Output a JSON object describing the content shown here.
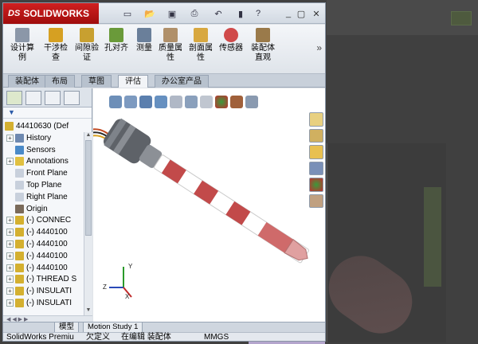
{
  "app": {
    "brand": "SOLIDWORKS",
    "brand_logo": "DS"
  },
  "quick_access": [
    "new-icon",
    "open-icon",
    "save-icon",
    "print-icon",
    "undo-icon",
    "rebuild-icon",
    "help-icon"
  ],
  "window_controls": [
    "minimize",
    "restore",
    "close"
  ],
  "ribbon": {
    "commands": [
      {
        "id": "design-study",
        "label": "设计算\n例"
      },
      {
        "id": "interference",
        "label": "干涉检\n查"
      },
      {
        "id": "clearance",
        "label": "间隙验\n证"
      },
      {
        "id": "hole-align",
        "label": "孔对齐"
      },
      {
        "id": "measure",
        "label": "测量"
      },
      {
        "id": "mass-props",
        "label": "质量属\n性"
      },
      {
        "id": "section-props",
        "label": "剖面属\n性"
      },
      {
        "id": "sensor",
        "label": "传感器"
      },
      {
        "id": "assembly-visual",
        "label": "装配体\n直观"
      }
    ],
    "more": "»"
  },
  "tabs": [
    {
      "id": "assembly",
      "label": "装配体"
    },
    {
      "id": "layout",
      "label": "布局"
    },
    {
      "id": "sketch",
      "label": "草图"
    },
    {
      "id": "evaluate",
      "label": "评估",
      "active": true
    },
    {
      "id": "office",
      "label": "办公室产品"
    }
  ],
  "tree": {
    "root": "44410630  (Def",
    "items": [
      {
        "label": "History",
        "exp": "+"
      },
      {
        "label": "Sensors",
        "exp": ""
      },
      {
        "label": "Annotations",
        "exp": "+"
      },
      {
        "label": "Front Plane",
        "exp": ""
      },
      {
        "label": "Top Plane",
        "exp": ""
      },
      {
        "label": "Right Plane",
        "exp": ""
      },
      {
        "label": "Origin",
        "exp": ""
      },
      {
        "label": "(-) CONNEC",
        "exp": "+"
      },
      {
        "label": "(-) 4440100",
        "exp": "+"
      },
      {
        "label": "(-) 4440100",
        "exp": "+"
      },
      {
        "label": "(-) 4440100",
        "exp": "+"
      },
      {
        "label": "(-) 4440100",
        "exp": "+"
      },
      {
        "label": "(-) THREAD S",
        "exp": "+"
      },
      {
        "label": "(-) INSULATI",
        "exp": "+"
      },
      {
        "label": "(-) INSULATI",
        "exp": "+"
      }
    ]
  },
  "bottom_tabs": [
    {
      "label": "模型",
      "active": true
    },
    {
      "label": "Motion Study 1"
    }
  ],
  "status": {
    "app_name": "SolidWorks Premiu",
    "underdefined": "欠定义",
    "editing": "在编辑 装配体",
    "units": "MMGS"
  },
  "colors": {
    "brand_red": "#b81414",
    "rod_red": "#c24a4a",
    "rod_white": "#ffffff",
    "connector_gray": "#6b6f75",
    "tip_pink": "#e0a0a0"
  }
}
